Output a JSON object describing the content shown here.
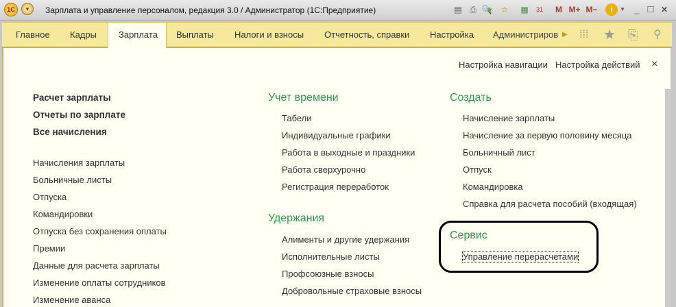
{
  "window": {
    "title": "Зарплата и управление персоналом, редакция 3.0 / Администратор  (1С:Предприятие)",
    "logo": "1С"
  },
  "toolbar": {
    "m": "M",
    "mplus": "M+",
    "mminus": "M−",
    "calendar_day": "31",
    "minimize": "_",
    "maximize": "□",
    "close": "✕"
  },
  "tabs": [
    "Главное",
    "Кадры",
    "Зарплата",
    "Выплаты",
    "Налоги и взносы",
    "Отчетность, справки",
    "Настройка",
    "Администриров"
  ],
  "active_tab": "Зарплата",
  "panel": {
    "nav_settings": "Настройка навигации",
    "action_settings": "Настройка действий",
    "close": "×"
  },
  "left": {
    "bold": [
      "Расчет зарплаты",
      "Отчеты по зарплате",
      "Все начисления"
    ],
    "items": [
      "Начисления зарплаты",
      "Больничные листы",
      "Отпуска",
      "Командировки",
      "Отпуска без сохранения оплаты",
      "Премии",
      "Данные для расчета зарплаты",
      "Изменение оплаты сотрудников",
      "Изменение аванса"
    ]
  },
  "middle": {
    "time": {
      "title": "Учет времени",
      "items": [
        "Табели",
        "Индивидуальные графики",
        "Работа в выходные и праздники",
        "Работа сверхурочно",
        "Регистрация переработок"
      ]
    },
    "deductions": {
      "title": "Удержания",
      "items": [
        "Алименты и другие удержания",
        "Исполнительные листы",
        "Профсоюзные взносы",
        "Добровольные страховые взносы"
      ]
    }
  },
  "right": {
    "create": {
      "title": "Создать",
      "items": [
        "Начисление зарплаты",
        "Начисление за первую половину месяца",
        "Больничный лист",
        "Отпуск",
        "Командировка",
        "Справка для расчета пособий (входящая)"
      ]
    },
    "service": {
      "title": "Сервис",
      "items": [
        "Управление перерасчетами"
      ]
    }
  }
}
